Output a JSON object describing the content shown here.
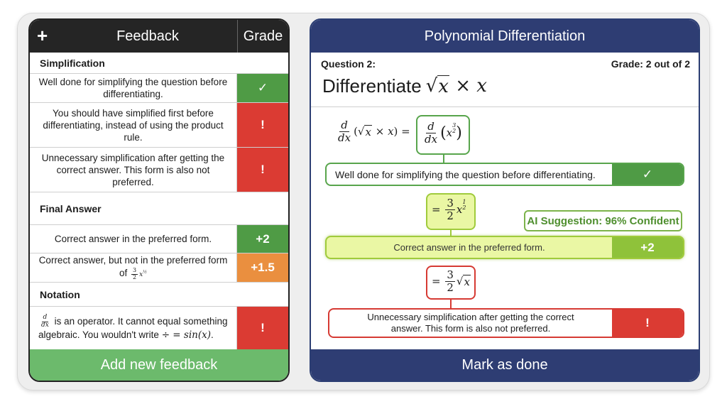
{
  "left_panel": {
    "header": {
      "add_icon": "plus-icon",
      "feedback_label": "Feedback",
      "grade_label": "Grade"
    },
    "sections": [
      {
        "title": "Simplification",
        "items": [
          {
            "text": "Well done for simplifying the question before differentiating.",
            "grade": "✓",
            "grade_icon": "check-icon",
            "color": "#4f9b45"
          },
          {
            "text": "You should have simplified first before differentiating, instead of using the product rule.",
            "grade": "!",
            "grade_icon": "exclamation-icon",
            "color": "#db3b33"
          },
          {
            "text": "Unnecessary simplification after getting the correct answer. This form is also not preferred.",
            "grade": "!",
            "grade_icon": "exclamation-icon",
            "color": "#db3b33"
          }
        ]
      },
      {
        "title": "Final Answer",
        "items": [
          {
            "text": "Correct answer in the preferred form.",
            "grade": "+2",
            "color": "#4f9b45"
          },
          {
            "text": "Correct answer, but not in the preferred form of",
            "math": "3/2 x^(1/2)",
            "grade": "+1.5",
            "color": "#ea8f3f"
          }
        ]
      },
      {
        "title": "Notation",
        "items": [
          {
            "text_a": "is an operator. It cannot equal something algebraic. You wouldn't write",
            "math_a": "d/dx",
            "math_b": "÷ = sin(x)",
            "text_end": ".",
            "grade": "!",
            "grade_icon": "exclamation-icon",
            "color": "#db3b33"
          }
        ]
      }
    ],
    "add_button": "Add new feedback"
  },
  "right_panel": {
    "title": "Polynomial Differentiation",
    "question_label": "Question 2:",
    "grade_label": "Grade: 2 out of 2",
    "question_text": "Differentiate",
    "question_math": "√x × x",
    "steps": [
      {
        "math": "d/dx(√x × x) = d/dx(x^(3/2))",
        "feedback": "Well done for simplifying the question before differentiating.",
        "grade": "✓",
        "grade_icon": "check-icon"
      },
      {
        "math": "= 3/2 x^(1/2)",
        "feedback": "Correct answer in the preferred form.",
        "grade": "+2",
        "ai_suggestion": "AI Suggestion: 96% Confident"
      },
      {
        "math": "= 3/2 √x",
        "feedback": "Unnecessary simplification after getting the correct answer. This form is also not preferred.",
        "grade": "!",
        "grade_icon": "exclamation-icon"
      }
    ],
    "mark_button": "Mark as done"
  },
  "colors": {
    "green": "#4f9b45",
    "red": "#db3b33",
    "orange": "#ea8f3f",
    "navy": "#2e3d73",
    "dark": "#252525",
    "light_green_button": "#6cba6c",
    "highlight_yellow": "#eaf7a4"
  }
}
